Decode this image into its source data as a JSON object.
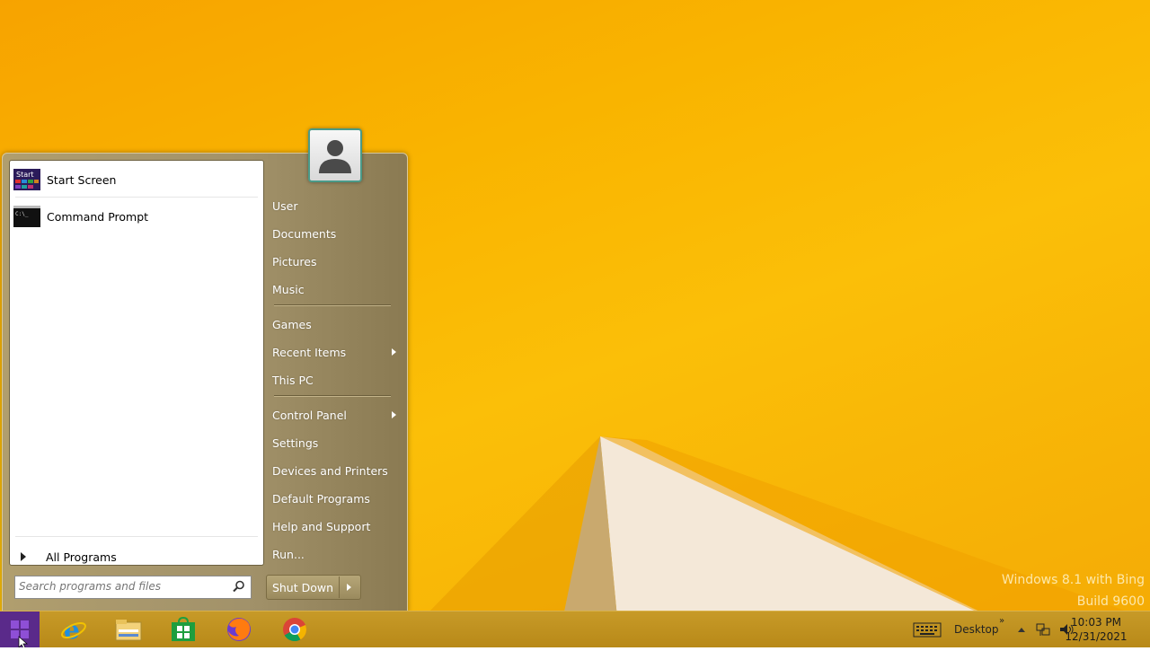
{
  "desktop": {
    "watermark_line1": "Windows 8.1 with Bing",
    "watermark_line2": "Build 9600"
  },
  "start_menu": {
    "pinned": [
      {
        "label": "Start Screen",
        "icon": "start-screen-icon"
      },
      {
        "label": "Command Prompt",
        "icon": "command-prompt-icon"
      }
    ],
    "all_programs": "All Programs",
    "search_placeholder": "Search programs and files",
    "right_items": [
      {
        "label": "User"
      },
      {
        "label": "Documents"
      },
      {
        "label": "Pictures"
      },
      {
        "label": "Music"
      },
      {
        "label": "Games"
      },
      {
        "label": "Recent Items",
        "submenu": true
      },
      {
        "label": "This PC"
      },
      {
        "label": "Control Panel",
        "submenu": true
      },
      {
        "label": "Settings"
      },
      {
        "label": "Devices and Printers"
      },
      {
        "label": "Default Programs"
      },
      {
        "label": "Help and Support"
      },
      {
        "label": "Run..."
      }
    ],
    "shutdown_label": "Shut Down"
  },
  "taskbar": {
    "apps": [
      "internet-explorer-icon",
      "file-explorer-icon",
      "store-icon",
      "firefox-icon",
      "chrome-icon"
    ],
    "toolbar_label": "Desktop",
    "time": "10:03 PM",
    "date": "12/31/2021"
  },
  "colors": {
    "wallpaper": "#f9b400",
    "menu_frame": "#a2926a",
    "taskbar": "#c0921f"
  }
}
